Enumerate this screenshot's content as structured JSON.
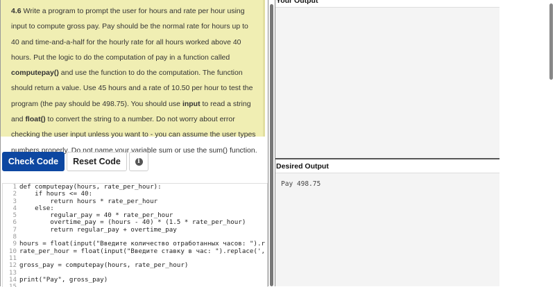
{
  "problem": {
    "segments": [
      {
        "t": "4.6",
        "b": true
      },
      {
        "t": " Write a program to prompt the user for hours and rate per hour using input to compute gross pay. Pay should be the normal rate for hours up to 40 and time-and-a-half for the hourly rate for all hours worked above 40 hours. Put the logic to do the computation of pay in a function called "
      },
      {
        "t": "computepay()",
        "b": true
      },
      {
        "t": " and use the function to do the computation. The function should return a value. Use 45 hours and a rate of 10.50 per hour to test the program (the pay should be 498.75). You should use "
      },
      {
        "t": "input",
        "b": true
      },
      {
        "t": " to read a string and "
      },
      {
        "t": "float()",
        "b": true
      },
      {
        "t": " to convert the string to a number. Do not worry about error checking the user input unless you want to - you can assume the user types numbers properly. Do not name your variable sum or use the sum() function."
      }
    ]
  },
  "buttons": {
    "check": "Check Code",
    "reset": "Reset Code",
    "info_icon": "info-icon"
  },
  "code": [
    "def computepay(hours, rate_per_hour):",
    "    if hours <= 40:",
    "        return hours * rate_per_hour",
    "    else:",
    "        regular_pay = 40 * rate_per_hour",
    "        overtime_pay = (hours - 40) * (1.5 * rate_per_hour)",
    "        return regular_pay + overtime_pay",
    "",
    "hours = float(input(\"Введите количество отработанных часов: \").r",
    "rate_per_hour = float(input(\"Введите ставку в час: \").replace(',",
    "",
    "gross_pay = computepay(hours, rate_per_hour)",
    "",
    "print(\"Pay\", gross_pay)",
    ""
  ],
  "output": {
    "your_title": "Your Output",
    "your_value": "",
    "desired_title": "Desired Output",
    "desired_value": "Pay 498.75"
  }
}
